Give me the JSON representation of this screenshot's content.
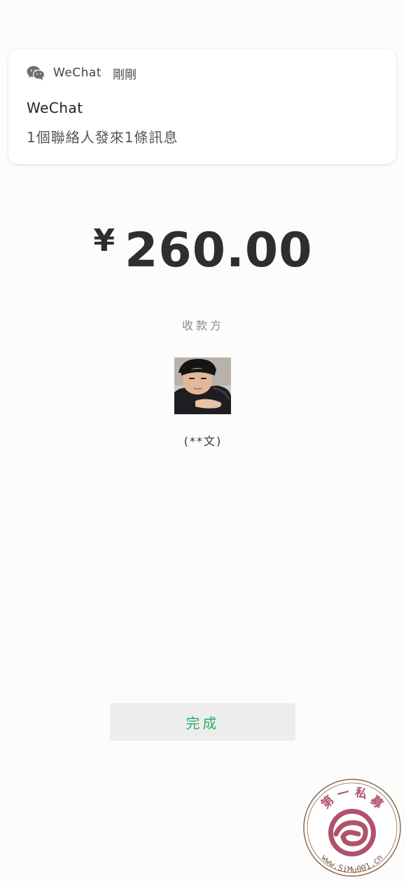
{
  "notification": {
    "app_name": "WeChat",
    "time": "剛剛",
    "title": "WeChat",
    "body": "1個聯絡人發來1條訊息",
    "icon": "wechat-icon"
  },
  "payment": {
    "currency_symbol": "¥",
    "amount": "260.00",
    "payee_label": "收款方",
    "payee_name": "(**文)"
  },
  "actions": {
    "done_label": "完成"
  },
  "watermark": {
    "text_top": "第 一 私 募",
    "text_bottom": "www.SiMu001.cn",
    "color": "#b0526a"
  },
  "colors": {
    "accent": "#2aae67",
    "button_bg": "#ededed"
  }
}
